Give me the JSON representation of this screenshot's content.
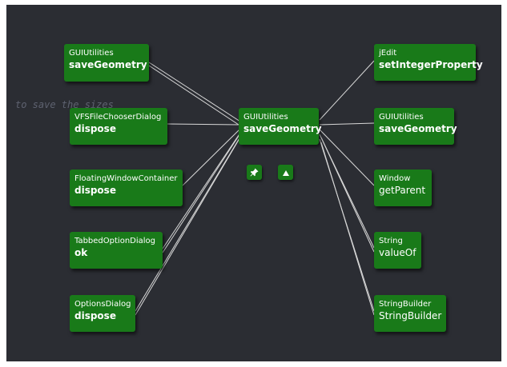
{
  "comment_text": "to save the sizes",
  "center": {
    "class": "GUIUtilities",
    "method": "saveGeometry"
  },
  "callers": [
    {
      "class": "GUIUtilities",
      "method": "saveGeometry"
    },
    {
      "class": "VFSFileChooserDialog",
      "method": "dispose"
    },
    {
      "class": "FloatingWindowContainer",
      "method": "dispose"
    },
    {
      "class": "TabbedOptionDialog",
      "method": "ok"
    },
    {
      "class": "OptionsDialog",
      "method": "dispose"
    }
  ],
  "callees": [
    {
      "class": "jEdit",
      "method": "setIntegerProperty"
    },
    {
      "class": "GUIUtilities",
      "method": "saveGeometry"
    },
    {
      "class": "Window",
      "method": "getParent"
    },
    {
      "class": "String",
      "method": "valueOf"
    },
    {
      "class": "StringBuilder",
      "method": "StringBuilder"
    }
  ],
  "controls": {
    "pin_icon": "pin-icon",
    "up_icon": "triangle-up-icon"
  },
  "colors": {
    "background": "#2b2d33",
    "node": "#197a19",
    "edge": "#d8d8d8",
    "comment": "#5e6270"
  }
}
